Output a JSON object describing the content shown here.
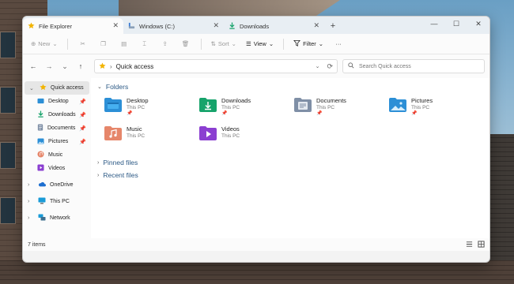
{
  "tabs": [
    {
      "label": "File Explorer",
      "icon": "star-icon",
      "active": true
    },
    {
      "label": "Windows (C:)",
      "icon": "drive-icon",
      "active": false
    },
    {
      "label": "Downloads",
      "icon": "download-arrow-icon",
      "active": false
    }
  ],
  "toolbar": {
    "new_label": "New",
    "sort_label": "Sort",
    "view_label": "View",
    "filter_label": "Filter",
    "more_label": "···"
  },
  "address": {
    "path": "Quick access",
    "search_placeholder": "Search Quick access"
  },
  "sidebar": {
    "quick_access": "Quick access",
    "items": [
      {
        "label": "Desktop",
        "pinned": true
      },
      {
        "label": "Downloads",
        "pinned": true
      },
      {
        "label": "Documents",
        "pinned": true
      },
      {
        "label": "Pictures",
        "pinned": true
      },
      {
        "label": "Music",
        "pinned": false
      },
      {
        "label": "Videos",
        "pinned": false
      }
    ],
    "onedrive": "OneDrive",
    "thispc": "This PC",
    "network": "Network"
  },
  "main": {
    "folders_header": "Folders",
    "folders": [
      {
        "name": "Desktop",
        "location": "This PC",
        "pinned": true
      },
      {
        "name": "Downloads",
        "location": "This PC",
        "pinned": true
      },
      {
        "name": "Documents",
        "location": "This PC",
        "pinned": true
      },
      {
        "name": "Pictures",
        "location": "This PC",
        "pinned": true
      },
      {
        "name": "Music",
        "location": "This PC",
        "pinned": false
      },
      {
        "name": "Videos",
        "location": "This PC",
        "pinned": false
      }
    ],
    "pinned_files": "Pinned files",
    "recent_files": "Recent files"
  },
  "status": {
    "items_count": "7 items"
  },
  "colors": {
    "accent": "#2d5a86",
    "folder_blue": "#2c8fd6",
    "folder_teal": "#17a36b",
    "folder_gray": "#7f8fa6",
    "folder_orange": "#e6866a",
    "folder_purple": "#8b3fd1"
  }
}
